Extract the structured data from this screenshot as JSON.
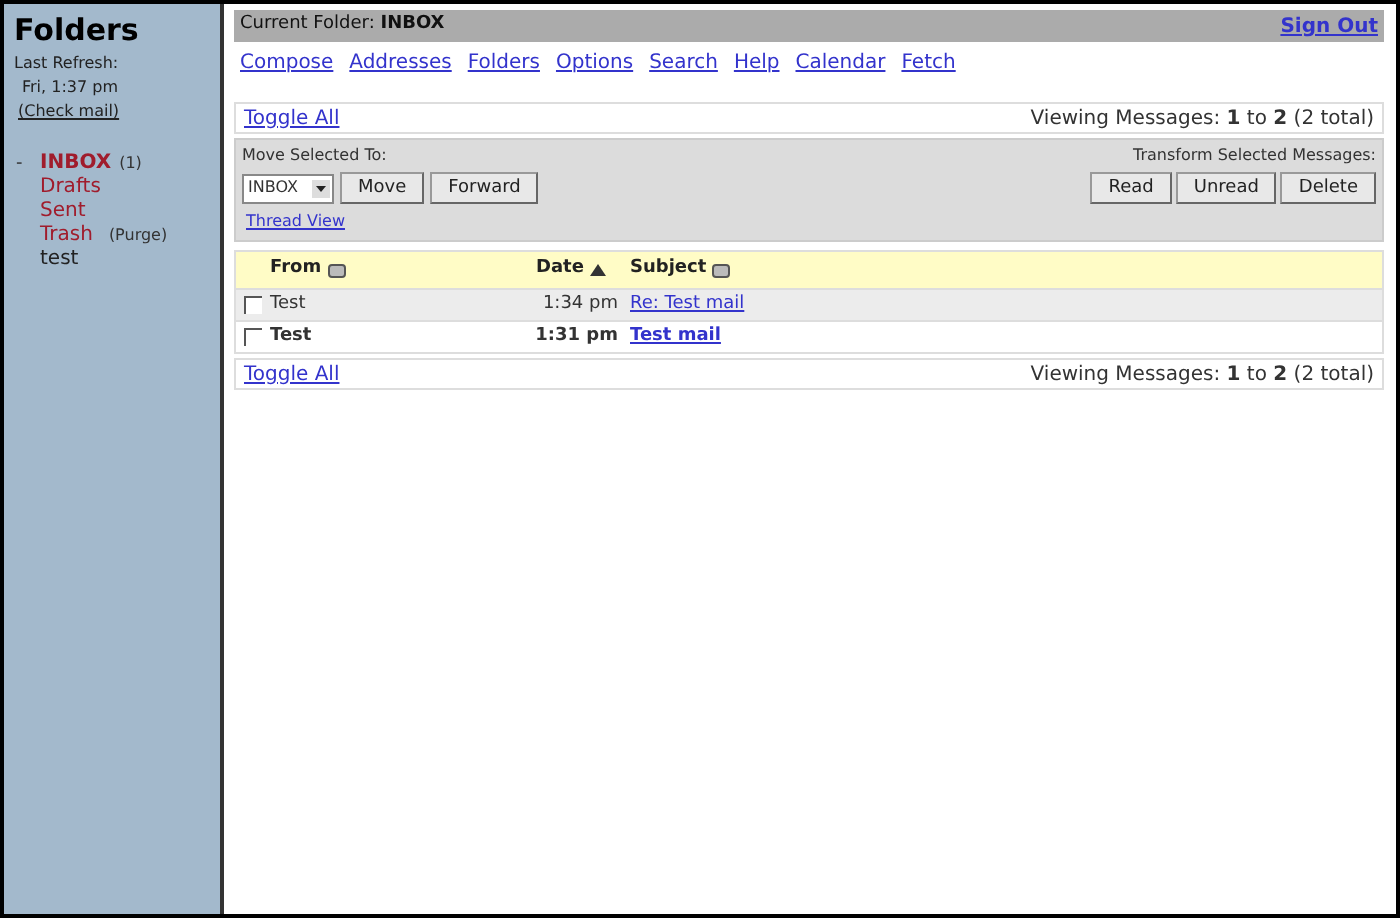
{
  "sidebar": {
    "title": "Folders",
    "refresh_label": "Last Refresh:",
    "refresh_time": "Fri, 1:37 pm",
    "check_mail": "(Check mail)",
    "folders": [
      {
        "marker": "-",
        "name": "INBOX",
        "count": "(1)",
        "unread": true,
        "special": true
      },
      {
        "name": "Drafts",
        "unread": false,
        "special": true
      },
      {
        "name": "Sent",
        "unread": false,
        "special": true
      },
      {
        "name": "Trash",
        "action": "(Purge)",
        "unread": false,
        "special": true
      },
      {
        "name": "test",
        "unread": false,
        "special": false
      }
    ]
  },
  "header": {
    "current_folder_label": "Current Folder:",
    "current_folder": "INBOX",
    "sign_out": "Sign Out"
  },
  "menu": [
    "Compose",
    "Addresses",
    "Folders",
    "Options",
    "Search",
    "Help",
    "Calendar",
    "Fetch"
  ],
  "top_bar": {
    "toggle_all": "Toggle All",
    "viewing": "Viewing Messages: **1** to **2** (2 total)"
  },
  "actions": {
    "move_label": "Move Selected To:",
    "folder_select": "INBOX",
    "move_buttons": [
      "Move",
      "Forward"
    ],
    "thread_view": "Thread View",
    "transform_label": "Transform Selected Messages:",
    "transform_buttons": [
      "Read",
      "Unread",
      "Delete"
    ]
  },
  "table": {
    "columns": [
      {
        "label": "From",
        "sorted": false
      },
      {
        "label": "Date",
        "sorted": true
      },
      {
        "label": "Subject",
        "sorted": false
      }
    ],
    "rows": [
      {
        "checked": false,
        "unread": false,
        "from": "Test",
        "date": "1:34 pm",
        "subject": "Re: Test mail"
      },
      {
        "checked": false,
        "unread": true,
        "from": "Test",
        "date": "1:31 pm",
        "subject": "Test mail"
      }
    ]
  },
  "bottom_bar": {
    "toggle_all": "Toggle All",
    "viewing": "Viewing Messages: **1** to **2** (2 total)"
  }
}
